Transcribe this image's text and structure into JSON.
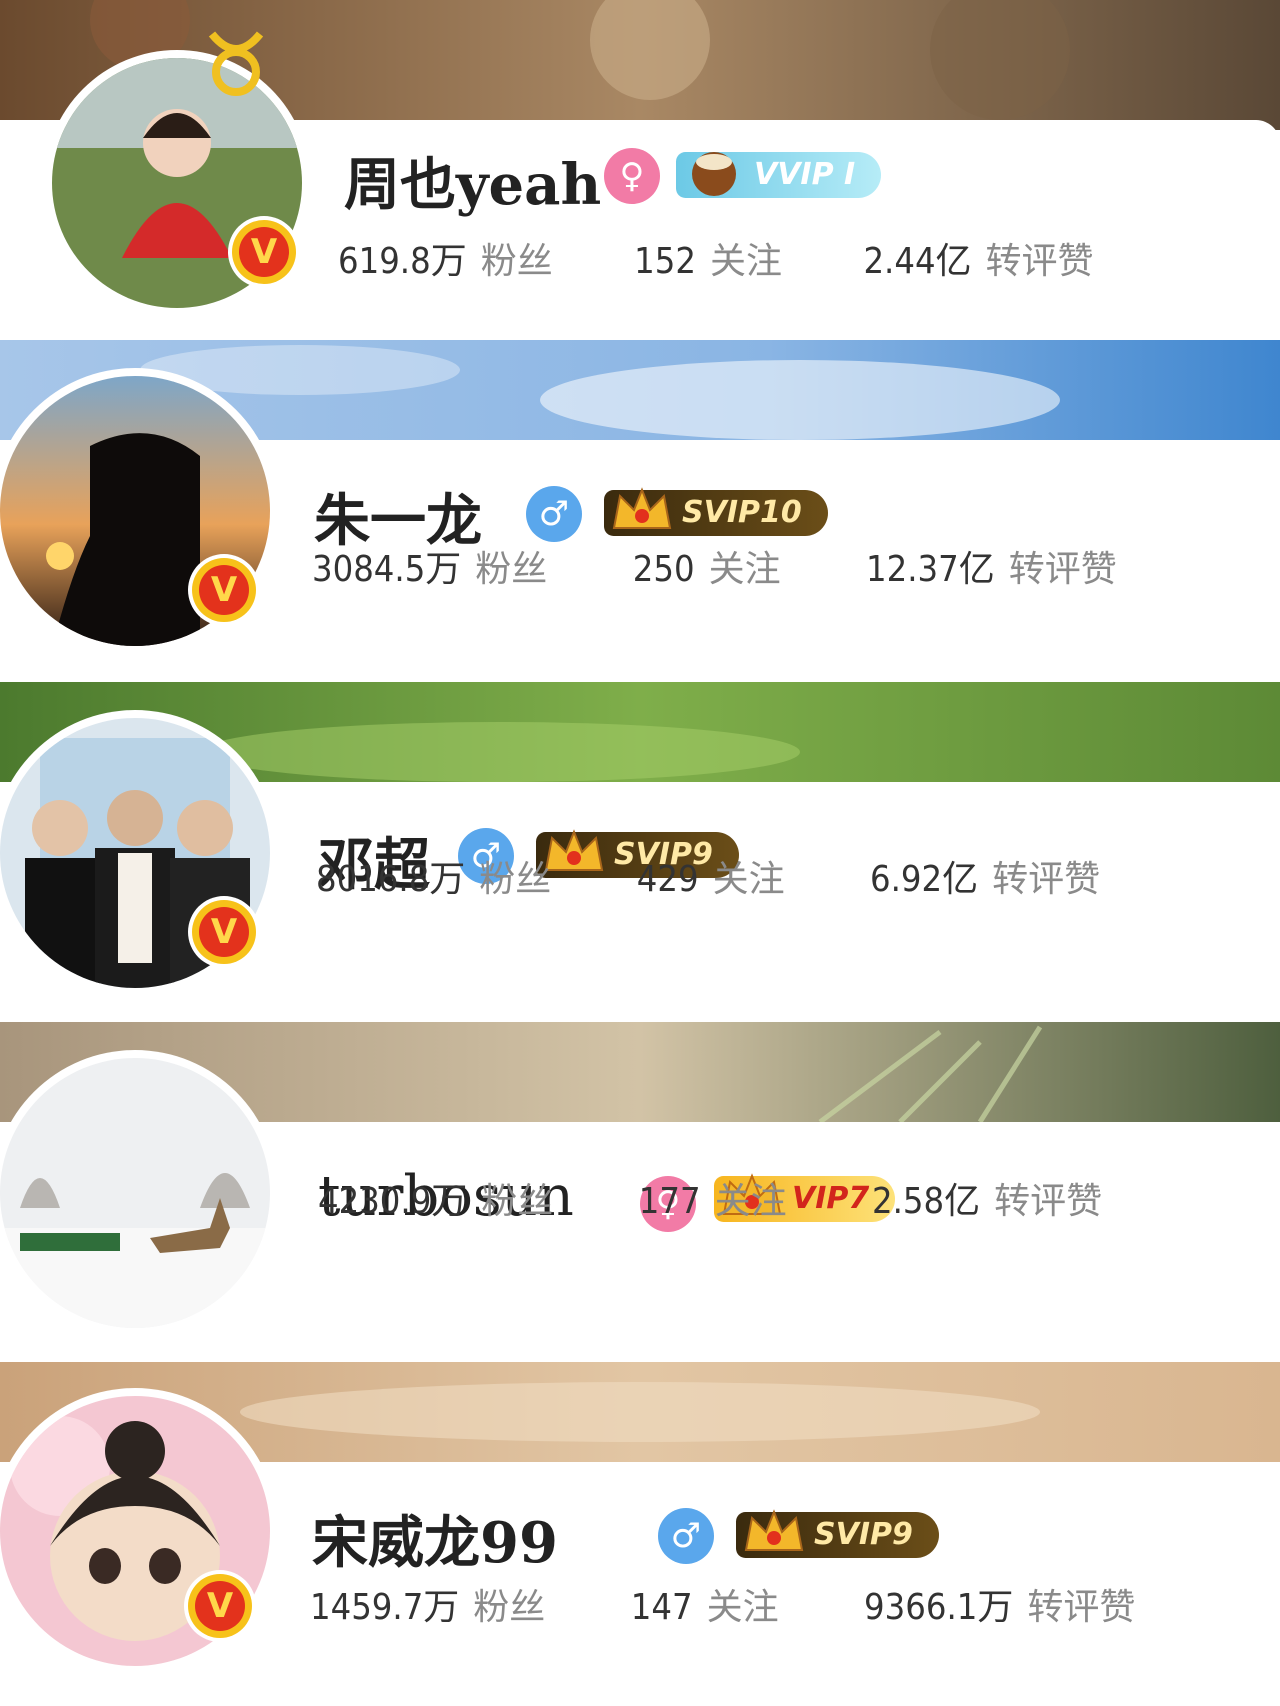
{
  "profiles": [
    {
      "name": "周也yeah",
      "gender": "♀",
      "vip": "VVIP",
      "vip_level": "I",
      "fans": "619.8万",
      "fans_label": "粉丝",
      "follow": "152",
      "follow_label": "关注",
      "engage": "2.44亿",
      "engage_label": "转评赞",
      "verified": "V"
    },
    {
      "name": "朱一龙",
      "gender": "♂",
      "vip": "SVIP10",
      "fans": "3084.5万",
      "fans_label": "粉丝",
      "follow": "250",
      "follow_label": "关注",
      "engage": "12.37亿",
      "engage_label": "转评赞",
      "verified": "V"
    },
    {
      "name": "邓超",
      "gender": "♂",
      "vip": "SVIP9",
      "fans": "8016.8万",
      "fans_label": "粉丝",
      "follow": "429",
      "follow_label": "关注",
      "engage": "6.92亿",
      "engage_label": "转评赞",
      "verified": "V"
    },
    {
      "name": "turbosun",
      "gender": "♀",
      "vip": "VIP7",
      "fans": "4230.9万",
      "fans_label": "粉丝",
      "follow": "177",
      "follow_label": "关注",
      "engage": "2.58亿",
      "engage_label": "转评赞"
    },
    {
      "name": "宋威龙99",
      "gender": "♂",
      "vip": "SVIP9",
      "fans": "1459.7万",
      "fans_label": "粉丝",
      "follow": "147",
      "follow_label": "关注",
      "engage": "9366.1万",
      "engage_label": "转评赞",
      "verified": "V"
    }
  ],
  "colors": {
    "female": "#f27ba6",
    "male": "#5aa7ec",
    "verified_red": "#e3321c",
    "verified_gold": "#f7c21a"
  }
}
